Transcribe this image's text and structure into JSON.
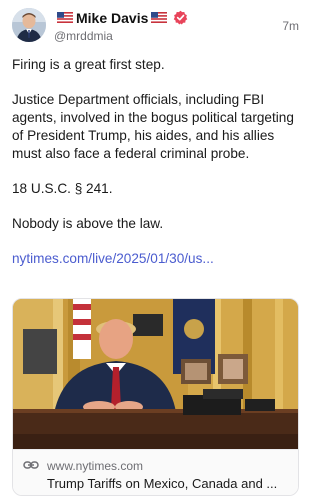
{
  "author": {
    "display_name": "Mike Davis",
    "handle": "@mrddmia",
    "flag_left": "🇺🇸",
    "flag_right": "🇺🇸",
    "verified_icon": "verified-badge-icon",
    "badge_color": "#e8445a"
  },
  "post": {
    "time": "7m",
    "paragraphs": [
      "Firing is a great first step.",
      "Justice Department officials, including FBI agents, involved in the bogus political targeting of President Trump, his aides, and his allies must also face a federal criminal probe.",
      "18 U.S.C. § 241.",
      "Nobody is above the law."
    ],
    "link_text": "nytimes.com/live/2025/01/30/us..."
  },
  "card": {
    "domain": "www.nytimes.com",
    "title": "Trump Tariffs on Mexico, Canada and ...",
    "icon": "link-icon"
  },
  "colors": {
    "link": "#4b5ccf",
    "muted": "#6e6e73"
  }
}
